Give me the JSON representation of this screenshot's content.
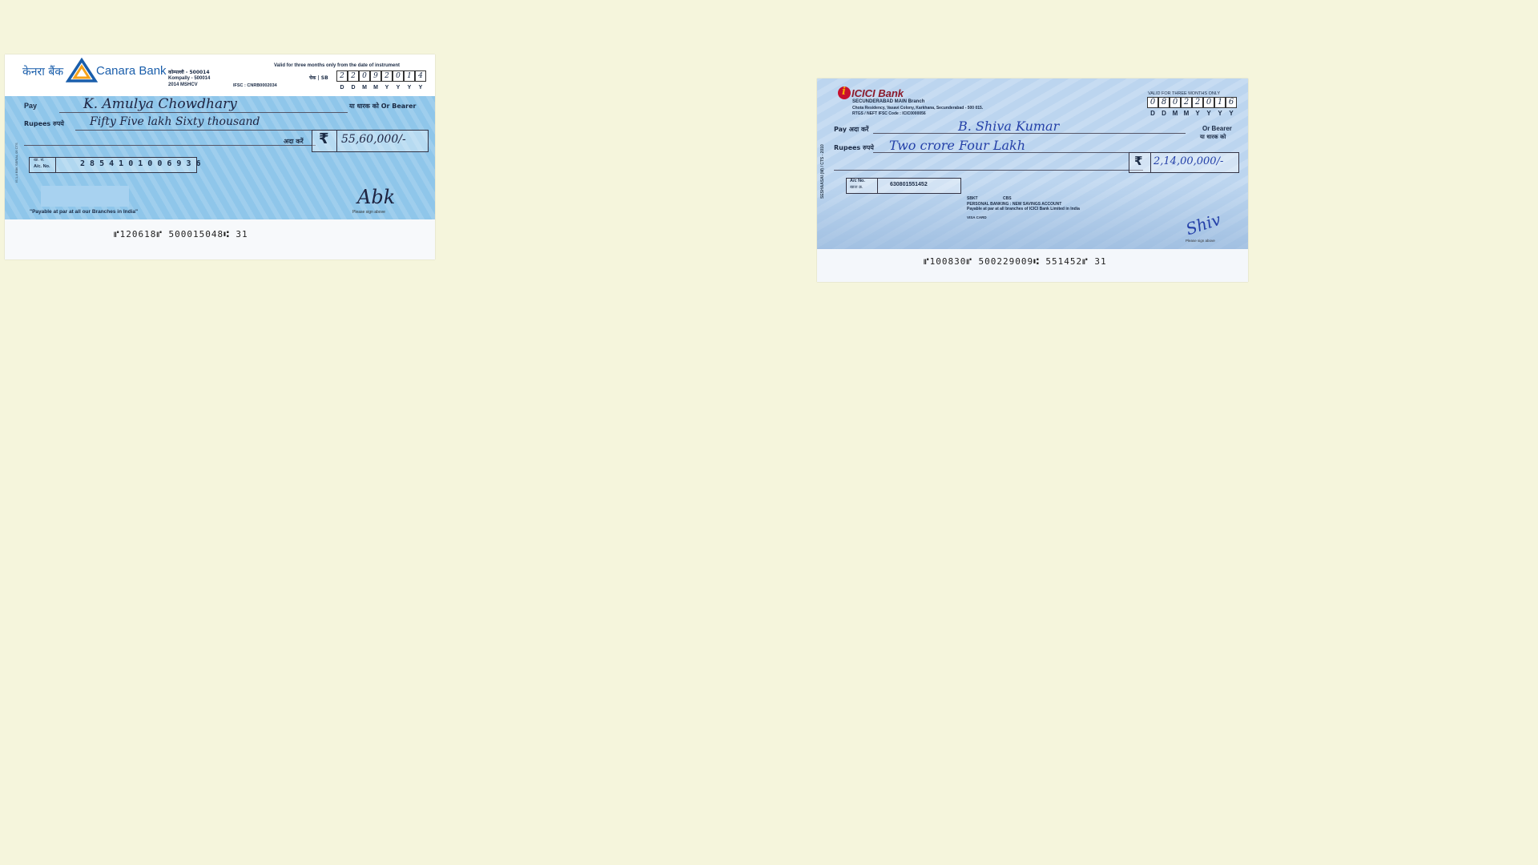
{
  "canara": {
    "logo_hindi": "केनरा बैंक",
    "logo_english": "Canara Bank",
    "branch_hindi": "कोम्पल्ली - 500014",
    "branch_line1": "Kompally - 500014",
    "branch_line2": "2014 MSHCV",
    "ifsc": "IFSC : CNRB0002034",
    "validity": "Valid for three months only from the date of instrument",
    "date_prefix": "चेक | SB",
    "date_digits": [
      "2",
      "2",
      "0",
      "9",
      "2",
      "0",
      "1",
      "4"
    ],
    "date_letters": [
      "D",
      "D",
      "M",
      "M",
      "Y",
      "Y",
      "Y",
      "Y"
    ],
    "pay_label": "Pay",
    "payee": "K. Amulya Chowdhary",
    "bearer_label": "या धारक को Or Bearer",
    "rupees_label": "Rupees रुपये",
    "amount_words": "Fifty Five lakh Sixty thousand",
    "ada_kare": "अदा करें",
    "rupee_symbol": "₹",
    "amount_figures": "55,60,000/-",
    "acno_label_hindi": "खा. सं.",
    "acno_label": "A/c. No.",
    "account_number": "2 8 5 4 1 0 1 0 0 6 9 3 6",
    "payable_note": "\"Payable at par at all our Branches in India\"",
    "sign_note": "Please sign above",
    "signature": "Abk",
    "micr": "⑈120618⑈  500015048⑆     31",
    "side_text": "IS 1-4 BBK SERIAL 05 CTS"
  },
  "icici": {
    "logo_letter": "i",
    "logo_text": "ICICI Bank",
    "branch": "SECUNDERABAD MAIN Branch",
    "address": "Chota Residency, Vasavi Colony, Karkhana, Secunderabad - 500 015.",
    "ifsc": "RTGS / NEFT IFSC Code : ICIC0000056",
    "validity": "VALID FOR THREE MONTHS ONLY",
    "date_digits": [
      "0",
      "8",
      "0",
      "2",
      "2",
      "0",
      "1",
      "6"
    ],
    "date_letters": [
      "D",
      "D",
      "M",
      "M",
      "Y",
      "Y",
      "Y",
      "Y"
    ],
    "pay_label": "Pay अदा करें",
    "payee": "B. Shiva Kumar",
    "bearer_label": "Or Bearer",
    "bearer_hindi": "या धारक को",
    "rupees_label": "Rupees रुपये",
    "amount_words": "Two crore Four Lakh",
    "rupee_symbol": "₹",
    "amount_figures": "2,14,00,000/-",
    "acno_label": "A/c No.",
    "acno_label_hindi": "खाता क्र.",
    "account_number": "630801551452",
    "account_code1": "SBKT",
    "account_code2": "CBS",
    "account_type": "PERSONAL BANKING : NEW SAVINGS ACCOUNT",
    "payable_note": "Payable at par at all branches of ICICI Bank Limited in India",
    "visa_note": "VISA CARD",
    "sign_note": "Please sign above",
    "signature": "Shiv",
    "micr": "⑈100830⑈  500229009⑆  551452⑈  31",
    "side_text": "SESHAASAI (M) / CTS - 2010"
  }
}
